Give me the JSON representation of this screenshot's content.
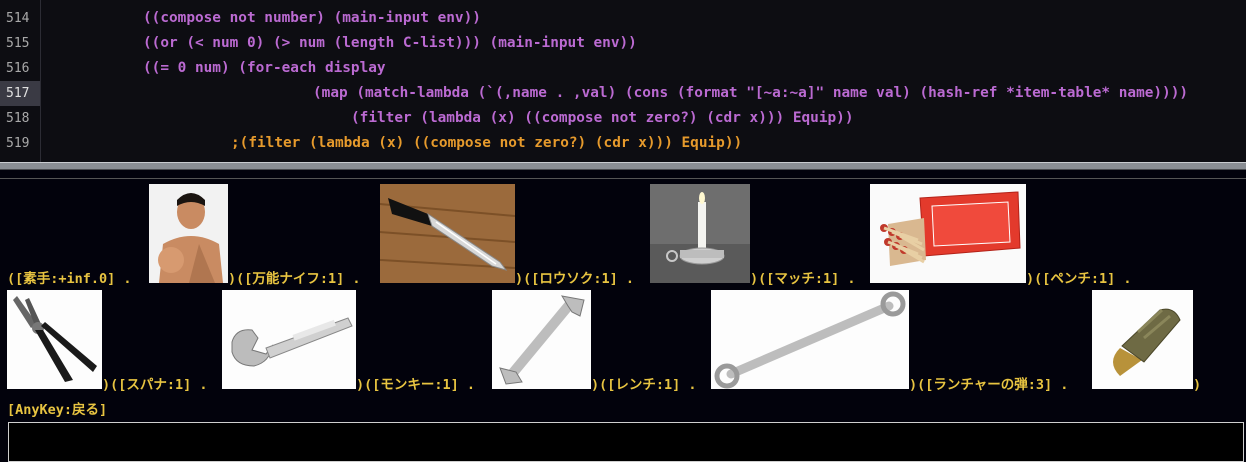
{
  "editor": {
    "lines": [
      {
        "number": "514",
        "text": "((compose not number) (main-input env))"
      },
      {
        "number": "515",
        "text": "((or (< num 0) (> num (length C-list))) (main-input env))"
      },
      {
        "number": "516",
        "text": "((= 0 num) (for-each display"
      },
      {
        "number": "517",
        "text": "(map (match-lambda (`(,name . ,val) (cons (format \"[~a:~a]\" name val) (hash-ref *item-table* name))))"
      },
      {
        "number": "518",
        "text": "(filter (lambda (x) ((compose not zero?) (cdr x))) Equip))"
      },
      {
        "number": "519",
        "text": ";(filter (lambda (x) ((compose not zero?) (cdr x))) Equip))"
      }
    ]
  },
  "items_row1": [
    {
      "label": "([素手:+inf.0] .",
      "image": "person-photo"
    },
    {
      "label": ")([万能ナイフ:1] .",
      "image": "knife-photo"
    },
    {
      "label": ")([ロウソク:1] .",
      "image": "candle-photo"
    },
    {
      "label": ")([マッチ:1] .",
      "image": "matchbox-photo"
    },
    {
      "label": ")([ペンチ:1] .",
      "image": ""
    }
  ],
  "items_row2": [
    {
      "label": "",
      "image": "pliers-photo"
    },
    {
      "label": ")([スパナ:1] .",
      "image": "spanner-photo"
    },
    {
      "label": ")([モンキー:1] .",
      "image": "wrench-open-photo"
    },
    {
      "label": ")([レンチ:1] .",
      "image": "long-wrench-photo"
    },
    {
      "label": ")([ランチャーの弾:3] .",
      "image": "grenade-photo"
    },
    {
      "label": ")",
      "image": ""
    }
  ],
  "prompt": "[AnyKey:戻る]",
  "colors": {
    "keyword": "#bb6ad2",
    "number": "#e0c44a",
    "function": "#52e052",
    "comment": "#e69a2c",
    "label": "#e8c441"
  }
}
